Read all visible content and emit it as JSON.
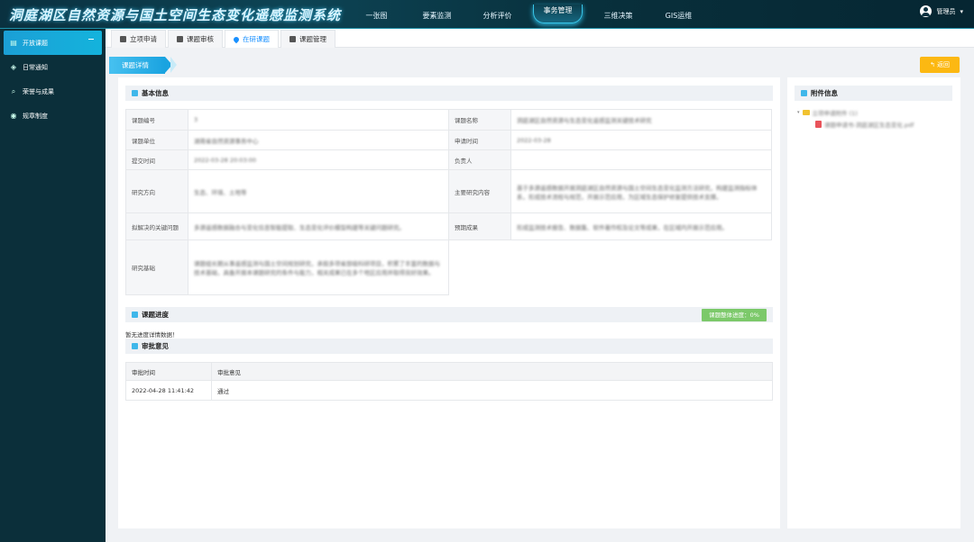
{
  "app": {
    "title": "洞庭湖区自然资源与国土空间生态变化遥感监测系统"
  },
  "topnav": [
    {
      "label": "一张图",
      "active": false
    },
    {
      "label": "要素监测",
      "active": false
    },
    {
      "label": "分析评价",
      "active": false
    },
    {
      "label": "事务管理",
      "active": true
    },
    {
      "label": "三维决策",
      "active": false
    },
    {
      "label": "GIS运维",
      "active": false
    }
  ],
  "user": {
    "name": "管理员",
    "caret": "▾"
  },
  "sidebar": {
    "items": [
      {
        "label": "开放课题",
        "icon": "document-icon",
        "glyph": "▤",
        "active": true
      },
      {
        "label": "日常通知",
        "icon": "layers-icon",
        "glyph": "◈",
        "active": false
      },
      {
        "label": "荣誉与成果",
        "icon": "search-icon",
        "glyph": "⌕",
        "active": false
      },
      {
        "label": "规章制度",
        "icon": "badge-icon",
        "glyph": "◉",
        "active": false
      }
    ]
  },
  "tabs": [
    {
      "label": "立项申请",
      "active": false
    },
    {
      "label": "课题审核",
      "active": false
    },
    {
      "label": "在研课题",
      "active": true
    },
    {
      "label": "课题管理",
      "active": false
    }
  ],
  "breadcrumb": {
    "label": "课题详情"
  },
  "back_button": {
    "label": "↰ 返回"
  },
  "basic_info": {
    "heading": "基本信息",
    "rows": [
      {
        "k1": "课题编号",
        "v1": "3",
        "k2": "课题名称",
        "v2": "洞庭湖区自然资源与生态变化遥感监测关键技术研究"
      },
      {
        "k1": "课题单位",
        "v1": "湖南省自然资源事务中心",
        "k2": "申请时间",
        "v2": "2022-03-28"
      },
      {
        "k1": "提交时间",
        "v1": "2022-03-28 20:03:00",
        "k2": "负责人",
        "v2": ""
      },
      {
        "k1": "研究方向",
        "v1": "生态、环境、土地等",
        "k2": "主要研究内容",
        "v2": "基于多源遥感数据开展洞庭湖区自然资源与国土空间生态变化监测方法研究，构建监测指标体系，形成技术流程与规范，开展示范应用，为区域生态保护修复提供技术支撑。"
      },
      {
        "k1": "拟解决的关键问题",
        "v1": "多源遥感数据融合与变化信息智能提取、生态变化评价模型构建等关键问题研究。",
        "k2": "预期成果",
        "v2": "形成监测技术报告、数据集、软件著作权及论文等成果，在区域内开展示范应用。"
      },
      {
        "k1": "研究基础",
        "v1": "课题组长期从事遥感监测与国土空间规划研究，承担多项省部级科研项目，积累了丰富的数据与技术基础，具备开展本课题研究的条件与能力，相关成果已在多个地区应用并取得良好效果。"
      }
    ]
  },
  "progress": {
    "heading": "课题进度",
    "badge": "课题整体进度：0%",
    "empty_text": "暂无进度详情数据！"
  },
  "review": {
    "heading": "审批意见",
    "columns": [
      "审批时间",
      "审批意见"
    ],
    "rows": [
      {
        "time": "2022-04-28 11:41:42",
        "opinion": "通过"
      }
    ]
  },
  "attachments": {
    "heading": "附件信息",
    "folder": "立项申请附件 (1)",
    "file": "课题申请书-洞庭湖区生态变化.pdf"
  },
  "colors": {
    "accent": "#1aa3e0",
    "header_bg": "#0a3140",
    "sidebar_bg": "#0b2f3a",
    "back_button": "#fcb812",
    "progress_badge": "#7cc96a"
  }
}
